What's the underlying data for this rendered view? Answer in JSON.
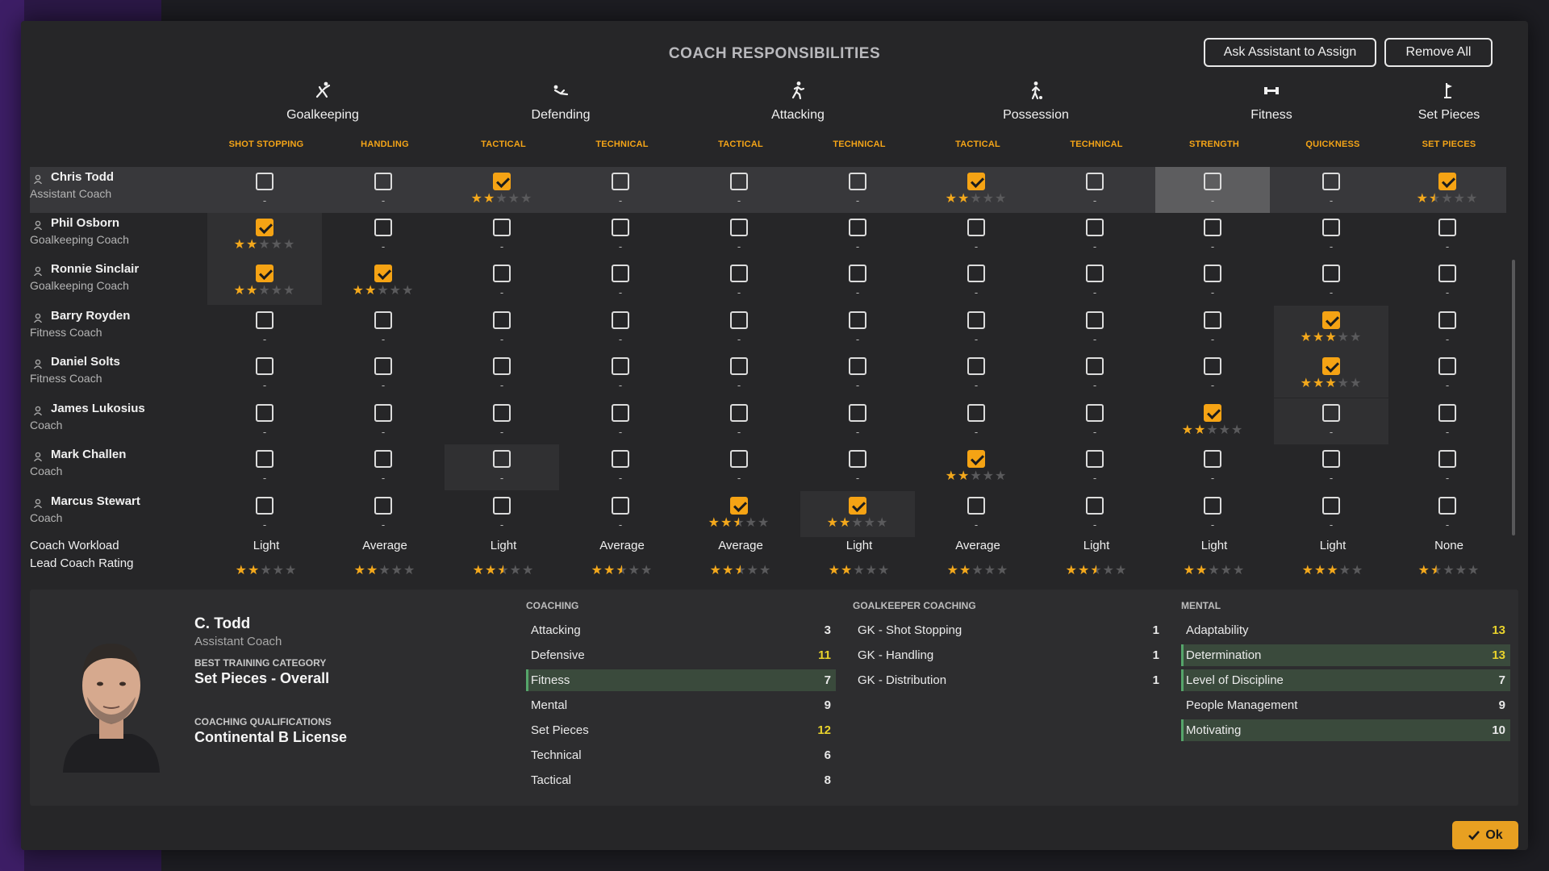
{
  "dialog": {
    "title": "COACH RESPONSIBILITIES",
    "assign_button": "Ask Assistant to Assign",
    "remove_button": "Remove All",
    "ok_button": "Ok",
    "ok_icon": "check-icon"
  },
  "categories": [
    {
      "label": "Goalkeeping",
      "icon": "goalkeeper-dive-icon"
    },
    {
      "label": "Defending",
      "icon": "slide-tackle-icon"
    },
    {
      "label": "Attacking",
      "icon": "running-player-icon"
    },
    {
      "label": "Possession",
      "icon": "player-dribble-icon"
    },
    {
      "label": "Fitness",
      "icon": "dumbbell-icon"
    },
    {
      "label": "Set Pieces",
      "icon": "corner-flag-icon"
    }
  ],
  "subcategories": [
    "SHOT STOPPING",
    "HANDLING",
    "TACTICAL",
    "TECHNICAL",
    "TACTICAL",
    "TECHNICAL",
    "TACTICAL",
    "TECHNICAL",
    "STRENGTH",
    "QUICKNESS",
    "SET PIECES"
  ],
  "coaches": [
    {
      "name": "Chris Todd",
      "role": "Assistant Coach",
      "selected": true,
      "checked": [
        false,
        false,
        true,
        false,
        false,
        false,
        true,
        false,
        false,
        false,
        true
      ],
      "stars": [
        null,
        null,
        2,
        null,
        null,
        null,
        2,
        null,
        null,
        null,
        1.5
      ]
    },
    {
      "name": "Phil Osborn",
      "role": "Goalkeeping Coach",
      "checked": [
        true,
        false,
        false,
        false,
        false,
        false,
        false,
        false,
        false,
        false,
        false
      ],
      "stars": [
        2,
        null,
        null,
        null,
        null,
        null,
        null,
        null,
        null,
        null,
        null
      ]
    },
    {
      "name": "Ronnie Sinclair",
      "role": "Goalkeeping Coach",
      "checked": [
        true,
        true,
        false,
        false,
        false,
        false,
        false,
        false,
        false,
        false,
        false
      ],
      "stars": [
        2,
        2,
        null,
        null,
        null,
        null,
        null,
        null,
        null,
        null,
        null
      ]
    },
    {
      "name": "Barry Royden",
      "role": "Fitness Coach",
      "checked": [
        false,
        false,
        false,
        false,
        false,
        false,
        false,
        false,
        false,
        true,
        false
      ],
      "stars": [
        null,
        null,
        null,
        null,
        null,
        null,
        null,
        null,
        null,
        3,
        null
      ]
    },
    {
      "name": "Daniel Solts",
      "role": "Fitness Coach",
      "checked": [
        false,
        false,
        false,
        false,
        false,
        false,
        false,
        false,
        false,
        true,
        false
      ],
      "stars": [
        null,
        null,
        null,
        null,
        null,
        null,
        null,
        null,
        null,
        3,
        null
      ]
    },
    {
      "name": "James Lukosius",
      "role": "Coach",
      "checked": [
        false,
        false,
        false,
        false,
        false,
        false,
        false,
        false,
        true,
        false,
        false
      ],
      "stars": [
        null,
        null,
        null,
        null,
        null,
        null,
        null,
        null,
        2,
        null,
        null
      ]
    },
    {
      "name": "Mark Challen",
      "role": "Coach",
      "checked": [
        false,
        false,
        false,
        false,
        false,
        false,
        true,
        false,
        false,
        false,
        false
      ],
      "stars": [
        null,
        null,
        null,
        null,
        null,
        null,
        2,
        null,
        null,
        null,
        null
      ]
    },
    {
      "name": "Marcus Stewart",
      "role": "Coach",
      "checked": [
        false,
        false,
        false,
        false,
        true,
        true,
        false,
        false,
        false,
        false,
        false
      ],
      "stars": [
        null,
        null,
        null,
        null,
        2.5,
        2,
        null,
        null,
        null,
        null,
        null
      ]
    }
  ],
  "footer": {
    "workload_label": "Coach Workload",
    "rating_label": "Lead Coach Rating",
    "workload": [
      "Light",
      "Average",
      "Light",
      "Average",
      "Average",
      "Light",
      "Average",
      "Light",
      "Light",
      "Light",
      "None"
    ],
    "rating": [
      2,
      2,
      2.5,
      2.5,
      2.5,
      2,
      2,
      2.5,
      2,
      3,
      1.5
    ]
  },
  "profile": {
    "name": "C. Todd",
    "role": "Assistant Coach",
    "best_label": "BEST TRAINING CATEGORY",
    "best_value": "Set Pieces - Overall",
    "qual_label": "COACHING QUALIFICATIONS",
    "qual_value": "Continental B License",
    "coaching_title": "COACHING",
    "coaching": [
      {
        "label": "Attacking",
        "value": "3"
      },
      {
        "label": "Defensive",
        "value": "11"
      },
      {
        "label": "Fitness",
        "value": "7"
      },
      {
        "label": "Mental",
        "value": "9"
      },
      {
        "label": "Set Pieces",
        "value": "12"
      },
      {
        "label": "Technical",
        "value": "6"
      },
      {
        "label": "Tactical",
        "value": "8"
      }
    ],
    "gk_title": "GOALKEEPER COACHING",
    "gk": [
      {
        "label": "GK - Shot Stopping",
        "value": "1"
      },
      {
        "label": "GK - Handling",
        "value": "1"
      },
      {
        "label": "GK - Distribution",
        "value": "1"
      }
    ],
    "mental_title": "MENTAL",
    "mental": [
      {
        "label": "Adaptability",
        "value": "13"
      },
      {
        "label": "Determination",
        "value": "13"
      },
      {
        "label": "Level of Discipline",
        "value": "7"
      },
      {
        "label": "People Management",
        "value": "9"
      },
      {
        "label": "Motivating",
        "value": "10"
      }
    ]
  },
  "colors": {
    "accent": "#f5a314",
    "star": "#f3a81c",
    "highlight_good": "#e8d22c",
    "row_highlight": "#3a4a3c"
  }
}
